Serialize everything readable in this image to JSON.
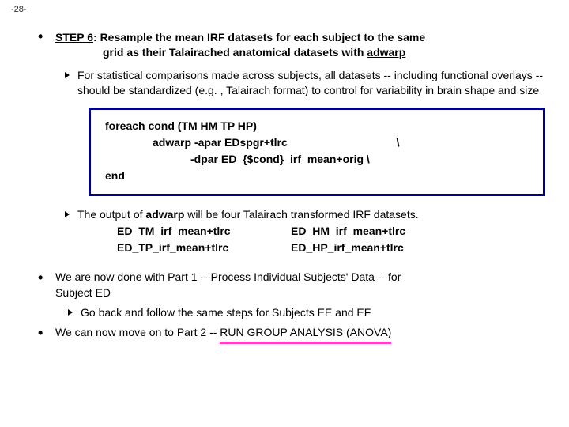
{
  "pageNumber": "-28-",
  "step": {
    "label": "STEP 6",
    "colon": ": ",
    "rest1": "Resample the mean IRF datasets for each subject to the same",
    "rest2": "grid as their Talairached anatomical datasets with ",
    "tool": "adwarp"
  },
  "sub1": "For statistical comparisons made across subjects, all datasets -- including functional overlays -- should be standardized (e.g. , Talairach format) to control for variability in brain shape and size",
  "code": {
    "l1": "foreach cond (TM HM TP HP)",
    "l2a": "adwarp  -apar EDspgr+tlrc",
    "l2b": "\\",
    "l3": "-dpar ED_{$cond}_irf_mean+orig  \\",
    "l4": "end"
  },
  "sub2_pre": "The output of ",
  "sub2_bold": "adwarp",
  "sub2_post": " will be four Talairach transformed IRF datasets.",
  "outputs": {
    "tm": "ED_TM_irf_mean+tlrc",
    "hm": "ED_HM_irf_mean+tlrc",
    "tp": "ED_TP_irf_mean+tlrc",
    "hp": "ED_HP_irf_mean+tlrc"
  },
  "done1a": "We are now done with Part 1 -- Process Individual Subjects' Data -- for",
  "done1b": "Subject ED",
  "sub3": "Go back and follow the same steps for Subjects EE and EF",
  "done2_pre": "We can now move on to Part 2 -- ",
  "done2_hl": "RUN GROUP ANALYSIS (ANOVA)"
}
